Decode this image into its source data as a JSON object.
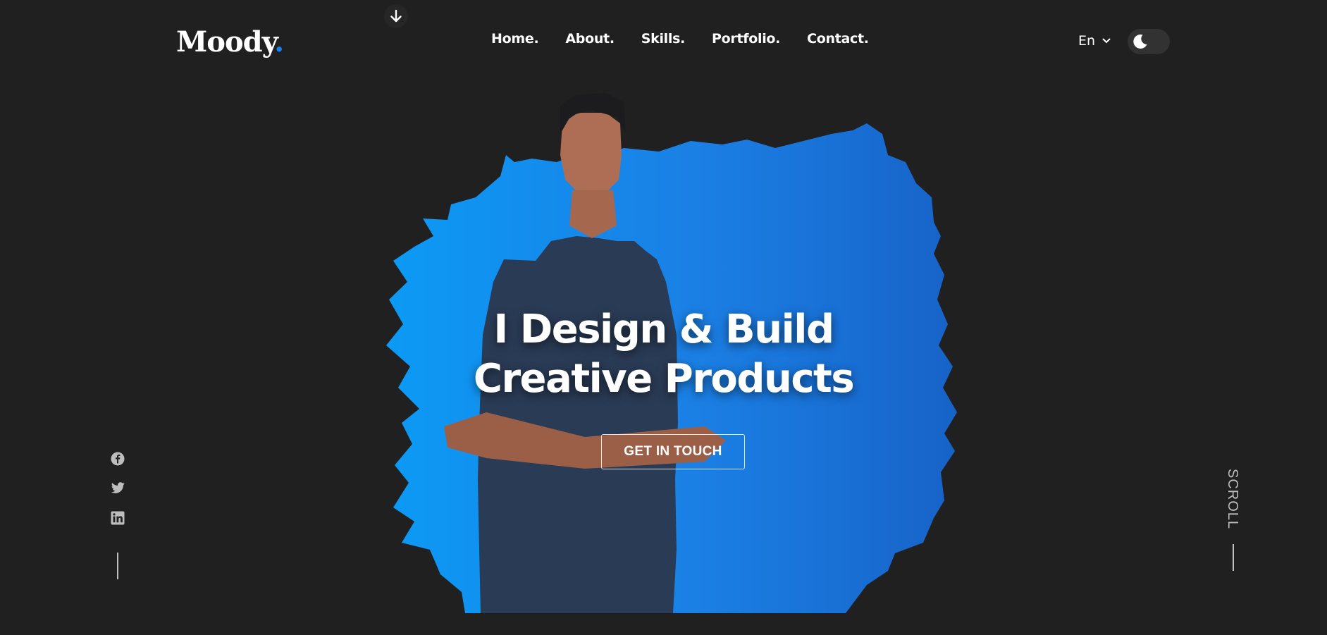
{
  "brand": {
    "name": "Moody",
    "dot": ".",
    "accent": "#1a7ff0"
  },
  "nav": {
    "items": [
      {
        "label": "Home."
      },
      {
        "label": "About."
      },
      {
        "label": "Skills."
      },
      {
        "label": "Portfolio."
      },
      {
        "label": "Contact."
      }
    ]
  },
  "header": {
    "language": "En",
    "download_icon": "arrow-down-icon",
    "theme_toggle_icon": "moon-icon"
  },
  "hero": {
    "headline_line1": "I Design & Build",
    "headline_line2": "Creative Products",
    "cta_label": "GET IN TOUCH",
    "splash_color": "#1a8fe8",
    "image_subject": "portrait-photo"
  },
  "social": {
    "icons": [
      "facebook-icon",
      "twitter-icon",
      "linkedin-icon"
    ]
  },
  "scroll": {
    "label": "SCROLL"
  },
  "colors": {
    "background": "#202020",
    "text": "#ffffff",
    "muted": "#bdbdbd"
  }
}
